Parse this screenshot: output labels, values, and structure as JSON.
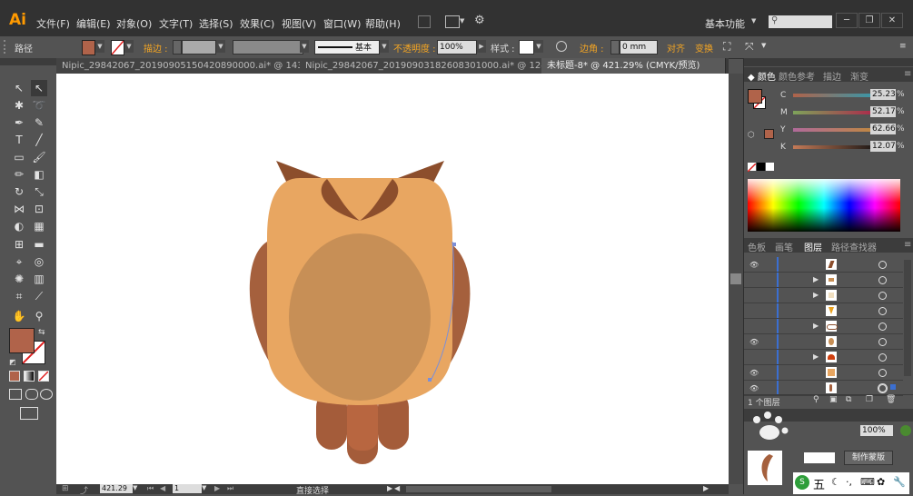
{
  "app": {
    "logo": "Ai"
  },
  "menus": [
    "文件(F)",
    "编辑(E)",
    "对象(O)",
    "文字(T)",
    "选择(S)",
    "效果(C)",
    "视图(V)",
    "窗口(W)",
    "帮助(H)"
  ],
  "workspace": "基本功能",
  "control": {
    "selection": "路径",
    "stroke_label": "描边 :",
    "stroke_style": "基本",
    "opacity_label": "不透明度 :",
    "opacity_value": "100%",
    "style_label": "样式 :",
    "corner_label": "边角 :",
    "corner_value": "0 mm",
    "align_label": "对齐",
    "transform_label": "变换"
  },
  "tabs": [
    "Nipic_29842067_20190905150420890000.ai* @ 143...",
    "Nipic_29842067_20190903182608301000.ai* @ 124...",
    "未标题-8* @ 421.29% (CMYK/预览)"
  ],
  "color_panel": {
    "tabs": [
      "颜色",
      "颜色参考",
      "描边",
      "渐变"
    ],
    "channels": [
      {
        "name": "C",
        "value": "25.23"
      },
      {
        "name": "M",
        "value": "52.17"
      },
      {
        "name": "Y",
        "value": "62.66"
      },
      {
        "name": "K",
        "value": "12.07"
      }
    ],
    "pct": "%"
  },
  "layers_panel": {
    "tabs": [
      "色板",
      "画笔",
      "图层",
      "路径查找器"
    ],
    "footer": "1 个图层"
  },
  "bottom_panel": {
    "opacity": "100%",
    "make_mask": "制作蒙版",
    "ime": "五"
  },
  "status": {
    "zoom": "421.29",
    "page": "1",
    "tool": "直接选择"
  },
  "colors": {
    "fill": "#b0634a",
    "owl_body": "#e8a661",
    "owl_belly": "#c78f56",
    "owl_wing": "#a5603d",
    "owl_dark": "#8c4e2c",
    "owl_feet": "#a45c3a",
    "owl_feet_mid": "#b86640"
  }
}
